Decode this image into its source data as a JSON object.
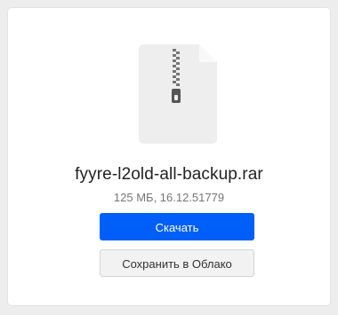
{
  "file": {
    "icon": "archive-file-icon",
    "name": "fyyre-l2old-all-backup.rar",
    "meta": "125 МБ, 16.12.51779"
  },
  "actions": {
    "download_label": "Скачать",
    "save_to_cloud_label": "Сохранить в Облако"
  },
  "colors": {
    "primary": "#005ff9",
    "file_icon_bg": "#eeeeee",
    "zipper": "#555555"
  }
}
